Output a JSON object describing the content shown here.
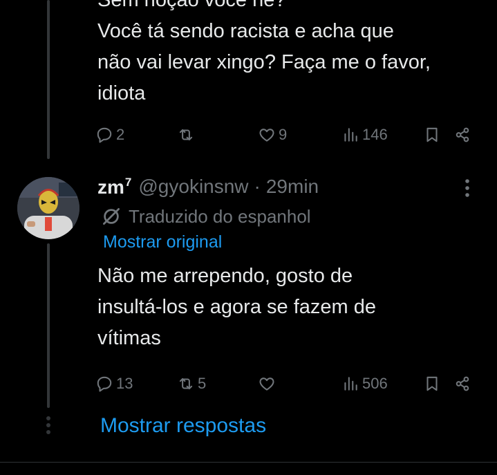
{
  "colors": {
    "background": "#000000",
    "text": "#e7e9ea",
    "muted": "#71767b",
    "link": "#1d9bf0",
    "thread_line": "#333639"
  },
  "tweet1": {
    "lines": [
      "Sem noção você né?",
      "Você tá sendo racista e acha que",
      "não vai levar xingo? Faça me o favor,",
      "idiota"
    ],
    "actions": {
      "reply_count": "2",
      "repost_count": "",
      "like_count": "9",
      "view_count": "146"
    }
  },
  "tweet2": {
    "display_name": "zm",
    "name_superscript": "7",
    "handle": "@gyokinsnw",
    "separator": "·",
    "time": "29min",
    "translated_label": "Traduzido do espanhol",
    "show_original": "Mostrar original",
    "lines": [
      "Não me arrependo, gosto de",
      "insultá-los e agora se fazem de",
      "vítimas"
    ],
    "actions": {
      "reply_count": "13",
      "repost_count": "5",
      "like_count": "",
      "view_count": "506"
    }
  },
  "show_replies": "Mostrar respostas",
  "icons": {
    "reply": "reply-icon",
    "repost": "repost-icon",
    "like": "heart-icon",
    "views": "views-icon",
    "bookmark": "bookmark-icon",
    "share": "share-icon",
    "more": "more-vertical-icon",
    "translate": "globe-translate-icon"
  }
}
